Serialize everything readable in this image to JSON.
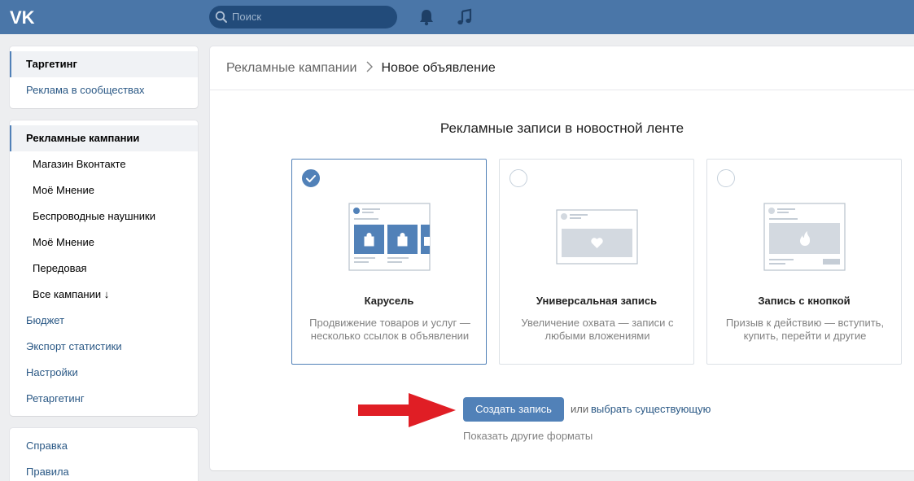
{
  "colors": {
    "header": "#4a76a8",
    "accent": "#5181b8",
    "link": "#2a5885",
    "arrow": "#e01e25"
  },
  "header": {
    "logo": "vk-logo",
    "search_placeholder": "Поиск",
    "icons": [
      "search-icon",
      "bell-icon",
      "music-icon"
    ]
  },
  "sidebar": {
    "group1": [
      "Таргетинг",
      "Реклама в сообществах"
    ],
    "group2": [
      "Рекламные кампании",
      "Магазин Вконтакте",
      "Моё Мнение",
      "Беспроводные наушники",
      "Моё Мнение",
      "Передовая",
      "Все кампании ↓",
      "Бюджет",
      "Экспорт статистики",
      "Настройки",
      "Ретаргетинг"
    ],
    "group3": [
      "Справка",
      "Правила"
    ],
    "active": [
      "Таргетинг",
      "Рекламные кампании"
    ]
  },
  "breadcrumb": {
    "parent": "Рекламные кампании",
    "current": "Новое объявление"
  },
  "main": {
    "section_title": "Рекламные записи в новостной ленте",
    "cards": [
      {
        "title": "Карусель",
        "description": "Продвижение товаров и услуг — несколько ссылок в объявлении",
        "selected": true,
        "icon": "carousel-illustration"
      },
      {
        "title": "Универсальная запись",
        "description": "Увеличение охвата — записи с любыми вложениями",
        "selected": false,
        "icon": "heart-post-illustration"
      },
      {
        "title": "Запись с кнопкой",
        "description": "Призыв к действию — вступить, купить, перейти и другие",
        "selected": false,
        "icon": "button-post-illustration"
      }
    ],
    "create_button": "Создать запись",
    "or_text": "или",
    "choose_existing": "выбрать существующую",
    "other_formats": "Показать другие форматы"
  }
}
